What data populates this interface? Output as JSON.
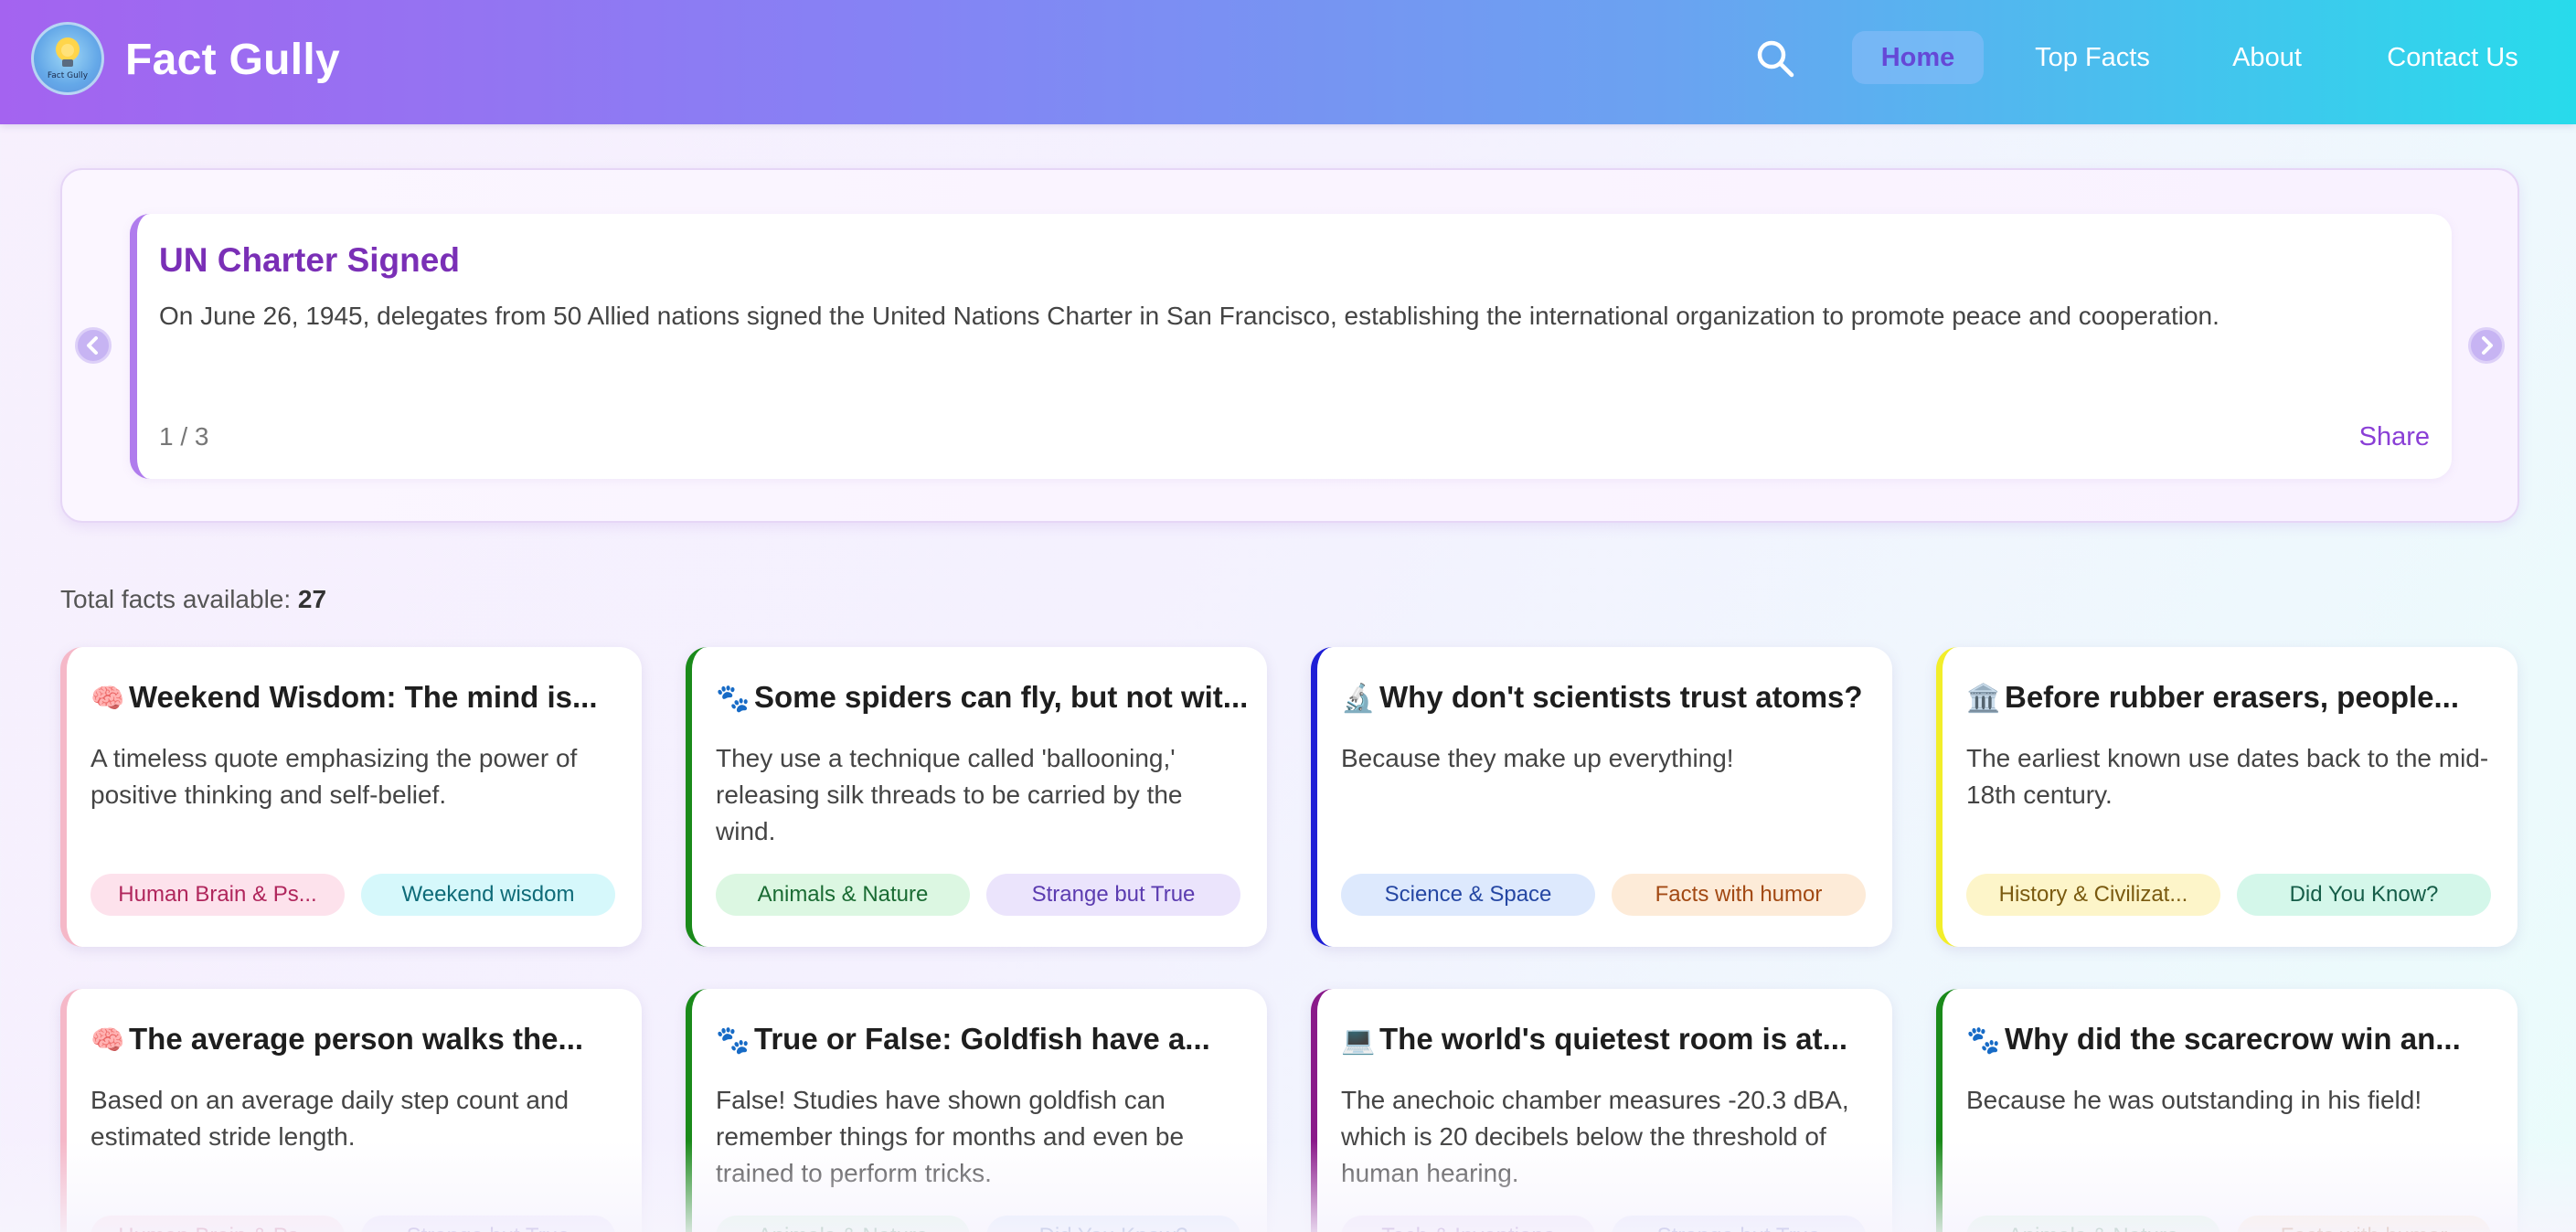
{
  "header": {
    "brand": "Fact Gully",
    "logo_text": "Fact Gully",
    "nav": [
      {
        "label": "Home",
        "active": true
      },
      {
        "label": "Top Facts",
        "active": false
      },
      {
        "label": "About",
        "active": false
      },
      {
        "label": "Contact Us",
        "active": false
      }
    ],
    "icons": {
      "search": "search-icon",
      "logo": "lightbulb-icon"
    }
  },
  "hero": {
    "title": "UN Charter Signed",
    "text": "On June 26, 1945, delegates from 50 Allied nations signed the United Nations Charter in San Francisco, establishing the international organization to promote peace and cooperation.",
    "counter": "1 / 3",
    "share": "Share",
    "icons": {
      "prev": "chevron-left-icon",
      "next": "chevron-right-icon"
    }
  },
  "totals": {
    "label": "Total facts available: ",
    "count": "27"
  },
  "colors": {
    "accent": "#7a2fb6",
    "header_start": "#a463f0",
    "header_end": "#28dbeb"
  },
  "cards": [
    {
      "emoji": "🧠",
      "icon": "brain-icon",
      "title": "Weekend Wisdom: The mind is...",
      "desc": "A timeless quote emphasizing the power of positive thinking and self-belief.",
      "border": "#f5b8c8",
      "tags": [
        {
          "label": "Human Brain & Ps...",
          "bg": "#fde2ec",
          "fg": "#b0265c"
        },
        {
          "label": "Weekend wisdom",
          "bg": "#d6f8fb",
          "fg": "#0e6b78"
        }
      ]
    },
    {
      "emoji": "🐾",
      "icon": "paw-icon",
      "title": "Some spiders can fly, but not wit...",
      "desc": "They use a technique called 'ballooning,' releasing silk threads to be carried by the wind.",
      "border": "#1a8a1a",
      "tags": [
        {
          "label": "Animals & Nature",
          "bg": "#dcf7e2",
          "fg": "#1a6b33"
        },
        {
          "label": "Strange but True",
          "bg": "#ebe4fc",
          "fg": "#5b3bb0"
        }
      ]
    },
    {
      "emoji": "🔬",
      "icon": "microscope-icon",
      "title": "Why don't scientists trust atoms?",
      "desc": "Because they make up everything!",
      "border": "#1f1fd6",
      "tags": [
        {
          "label": "Science & Space",
          "bg": "#dde9fd",
          "fg": "#2547a3"
        },
        {
          "label": "Facts with humor",
          "bg": "#fdebd8",
          "fg": "#a24913"
        }
      ]
    },
    {
      "emoji": "🏛️",
      "icon": "landmark-icon",
      "title": "Before rubber erasers, people...",
      "desc": "The earliest known use dates back to the mid-18th century.",
      "border": "#f2ee2a",
      "tags": [
        {
          "label": "History & Civilizat...",
          "bg": "#fdf5c9",
          "fg": "#7a5a10"
        },
        {
          "label": "Did You Know?",
          "bg": "#d4f7ea",
          "fg": "#155d48"
        }
      ]
    },
    {
      "emoji": "🧠",
      "icon": "brain-icon",
      "title": "The average person walks the...",
      "desc": "Based on an average daily step count and estimated stride length.",
      "border": "#f5b8c8",
      "tags": [
        {
          "label": "Human Brain & Ps...",
          "bg": "#fde2ec",
          "fg": "#b0265c"
        },
        {
          "label": "Strange but True",
          "bg": "#ebe4fc",
          "fg": "#5b3bb0"
        }
      ]
    },
    {
      "emoji": "🐾",
      "icon": "paw-icon",
      "title": "True or False: Goldfish have a...",
      "desc": "False! Studies have shown goldfish can remember things for months and even be trained to perform tricks.",
      "border": "#1a8a1a",
      "tags": [
        {
          "label": "Animals & Nature",
          "bg": "#dcf7e2",
          "fg": "#1a6b33"
        },
        {
          "label": "Did You Know?",
          "bg": "#dde9fd",
          "fg": "#2547a3"
        }
      ]
    },
    {
      "emoji": "💻",
      "icon": "laptop-icon",
      "title": "The world's quietest room is at...",
      "desc": "The anechoic chamber measures -20.3 dBA, which is 20 decibels below the threshold of human hearing.",
      "border": "#8a1a8a",
      "tags": [
        {
          "label": "Tech & Inventions",
          "bg": "#efe2fa",
          "fg": "#6a2a9a"
        },
        {
          "label": "Strange but True",
          "bg": "#e4e6fc",
          "fg": "#3b3fb0"
        }
      ]
    },
    {
      "emoji": "🐾",
      "icon": "paw-icon",
      "title": "Why did the scarecrow win an...",
      "desc": "Because he was outstanding in his field!",
      "border": "#1a8a1a",
      "tags": [
        {
          "label": "Animals & Nature",
          "bg": "#dcf7e2",
          "fg": "#1a6b33"
        },
        {
          "label": "Facts with humor",
          "bg": "#fdebd8",
          "fg": "#a24913"
        }
      ]
    }
  ]
}
